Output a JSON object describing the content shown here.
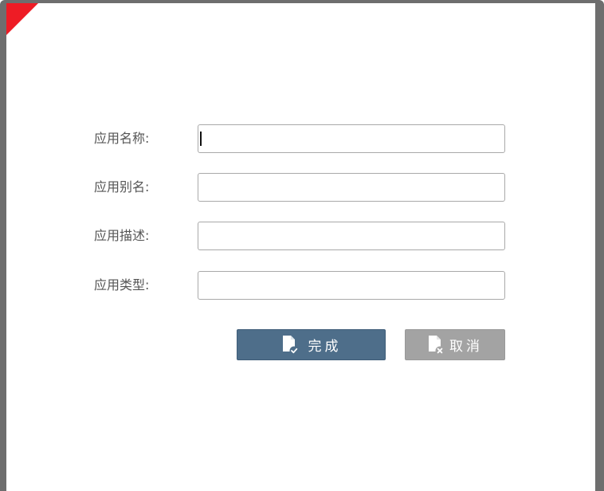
{
  "form": {
    "fields": [
      {
        "label": "应用名称:",
        "value": "",
        "placeholder": ""
      },
      {
        "label": "应用别名:",
        "value": "",
        "placeholder": ""
      },
      {
        "label": "应用描述:",
        "value": "",
        "placeholder": ""
      },
      {
        "label": "应用类型:",
        "value": "",
        "placeholder": ""
      }
    ]
  },
  "buttons": {
    "finish_label": "完成",
    "cancel_label": "取消",
    "finish_icon": "file-check-icon",
    "cancel_icon": "file-x-icon"
  },
  "colors": {
    "frame": "#6e6e6e",
    "corner_accent": "#ee1c25",
    "finish_button": "#4e6e8a",
    "cancel_button": "#a3a3a3"
  }
}
